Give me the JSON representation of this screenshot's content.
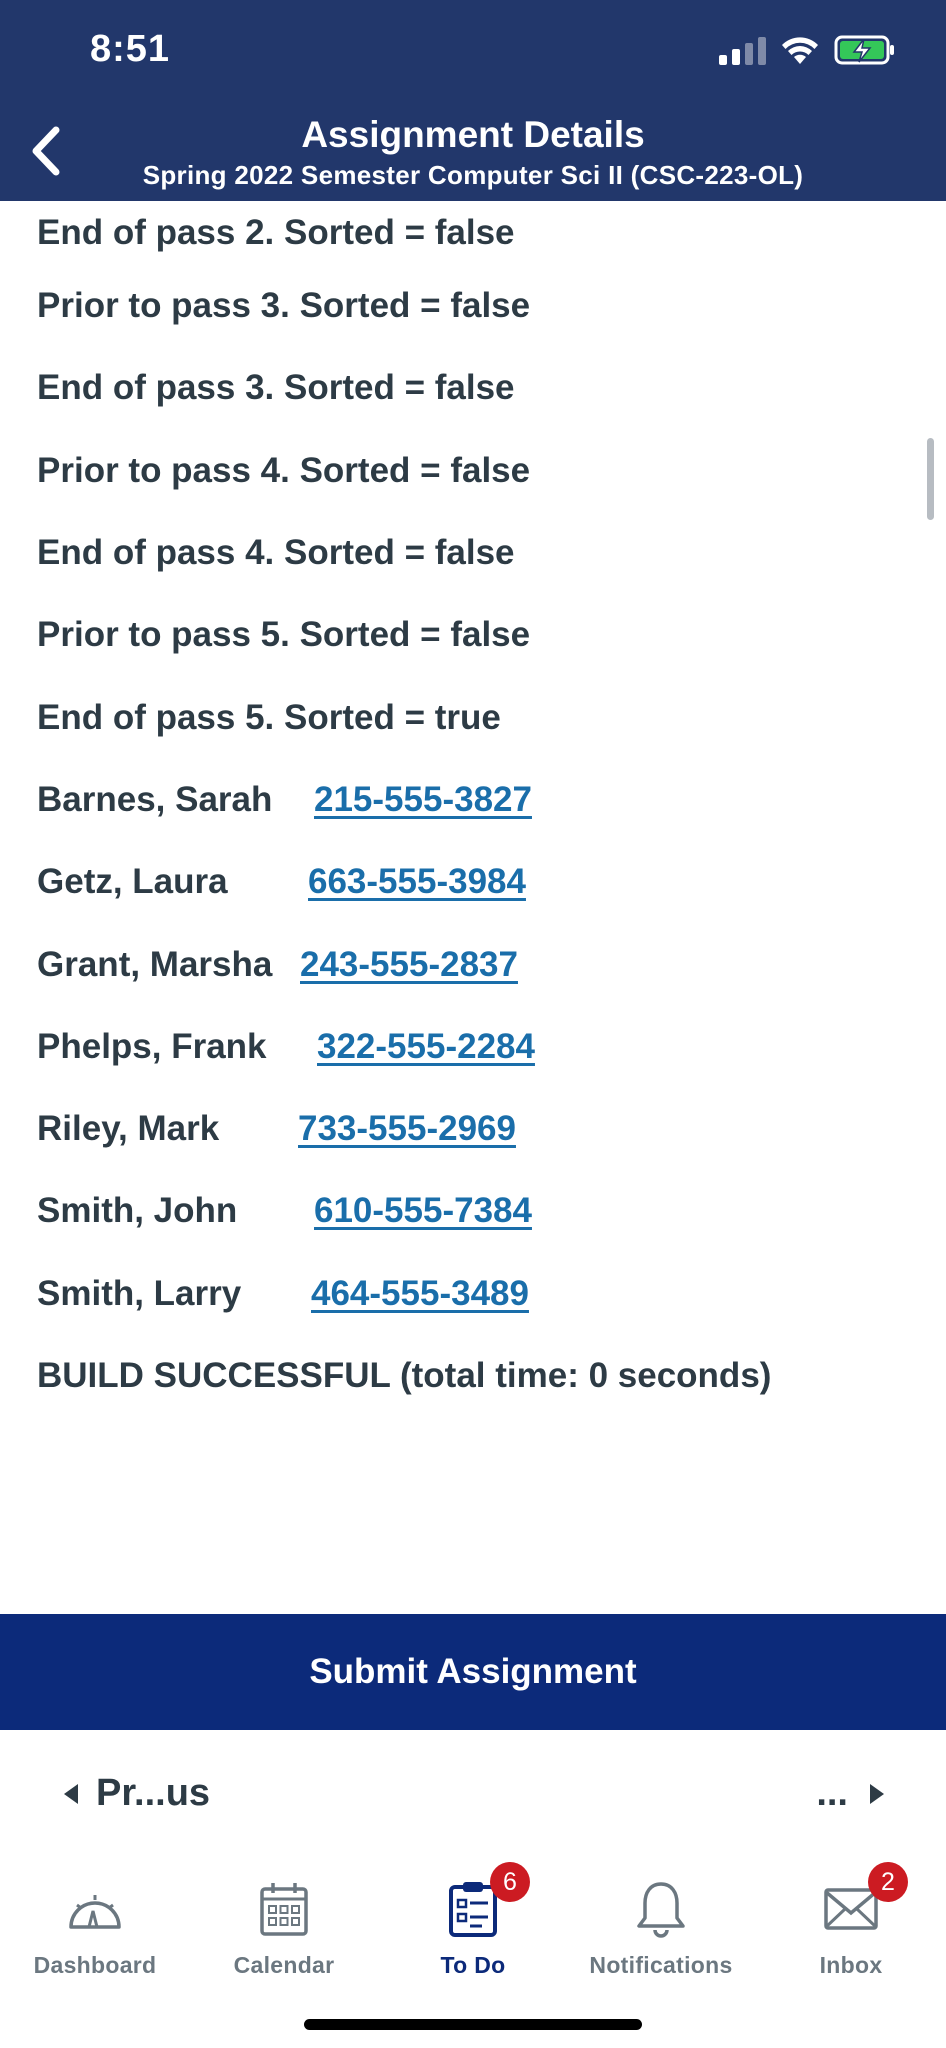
{
  "status_bar": {
    "time": "8:51"
  },
  "header": {
    "title": "Assignment Details",
    "subtitle": "Spring 2022 Semester Computer Sci II (CSC-223-OL)"
  },
  "output_lines": [
    "End of pass 2. Sorted = false",
    "Prior to pass 3. Sorted = false",
    "End of pass 3. Sorted = false",
    "Prior to pass 4. Sorted = false",
    "End of pass 4. Sorted = false",
    "Prior to pass 5. Sorted = false",
    "End of pass 5. Sorted = true"
  ],
  "contacts": [
    {
      "name": "Barnes, Sarah",
      "phone": "215-555-3827"
    },
    {
      "name": "Getz, Laura",
      "phone": "663-555-3984"
    },
    {
      "name": "Grant, Marsha",
      "phone": "243-555-2837"
    },
    {
      "name": "Phelps, Frank",
      "phone": "322-555-2284"
    },
    {
      "name": "Riley, Mark",
      "phone": "733-555-2969"
    },
    {
      "name": "Smith, John",
      "phone": "610-555-7384"
    },
    {
      "name": "Smith, Larry",
      "phone": "464-555-3489"
    }
  ],
  "build_line": "BUILD SUCCESSFUL (total time: 0 seconds)",
  "submit_label": "Submit Assignment",
  "pager": {
    "prev_label": "Pr...us",
    "next_label": "..."
  },
  "tabs": [
    {
      "label": "Dashboard",
      "icon": "dashboard-gauge-icon"
    },
    {
      "label": "Calendar",
      "icon": "calendar-icon"
    },
    {
      "label": "To Do",
      "icon": "clipboard-list-icon",
      "badge": "6"
    },
    {
      "label": "Notifications",
      "icon": "bell-icon"
    },
    {
      "label": "Inbox",
      "icon": "envelope-icon",
      "badge": "2"
    }
  ],
  "colors": {
    "header_bg": "#22376b",
    "submit_bg": "#0c2a7a",
    "link": "#1a6eaa",
    "badge": "#cc1b22",
    "text": "#2d3b45",
    "battery_green": "#34c759"
  }
}
